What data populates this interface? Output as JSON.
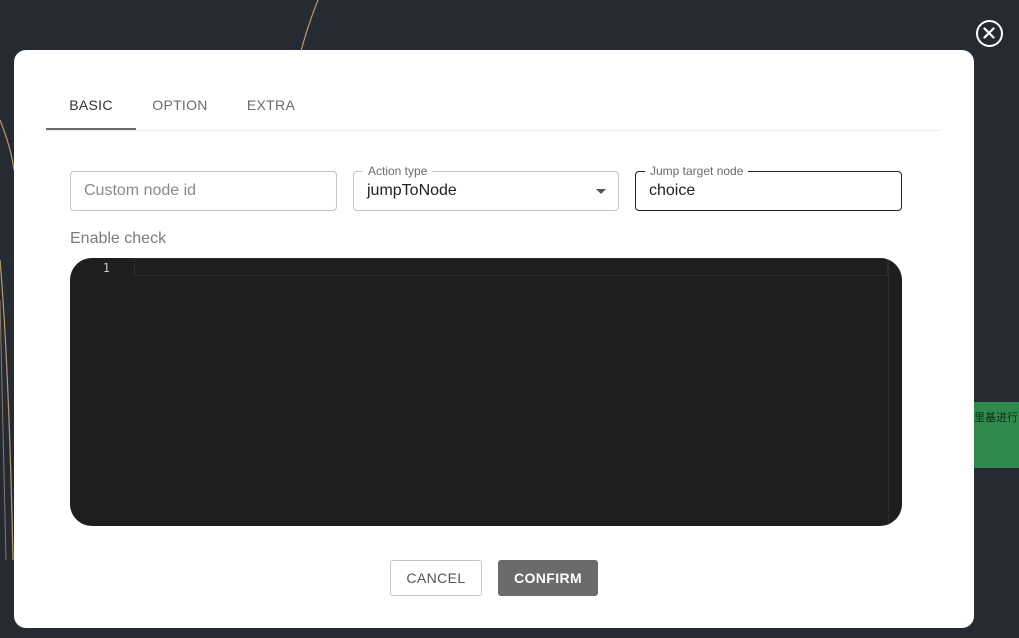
{
  "background": {
    "node_text": "里基进行了",
    "node_color": "#2f8a4d"
  },
  "close": {
    "icon": "close-circle-icon"
  },
  "dialog": {
    "tabs": [
      {
        "label": "BASIC",
        "active": true
      },
      {
        "label": "OPTION",
        "active": false
      },
      {
        "label": "EXTRA",
        "active": false
      }
    ],
    "fields": {
      "custom_node_id": {
        "placeholder": "Custom node id",
        "value": ""
      },
      "action_type": {
        "label": "Action type",
        "value": "jumpToNode",
        "icon": "caret-down-icon"
      },
      "jump_target": {
        "label": "Jump target node",
        "value": "choice"
      }
    },
    "enable_check": {
      "label": "Enable check",
      "editor": {
        "line_numbers": [
          "1"
        ],
        "content": ""
      }
    },
    "buttons": {
      "cancel": "CANCEL",
      "confirm": "CONFIRM"
    }
  },
  "colors": {
    "backdrop": "#262a33",
    "editor_bg": "#1e1e1e",
    "confirm_bg": "#6b6b6b"
  }
}
